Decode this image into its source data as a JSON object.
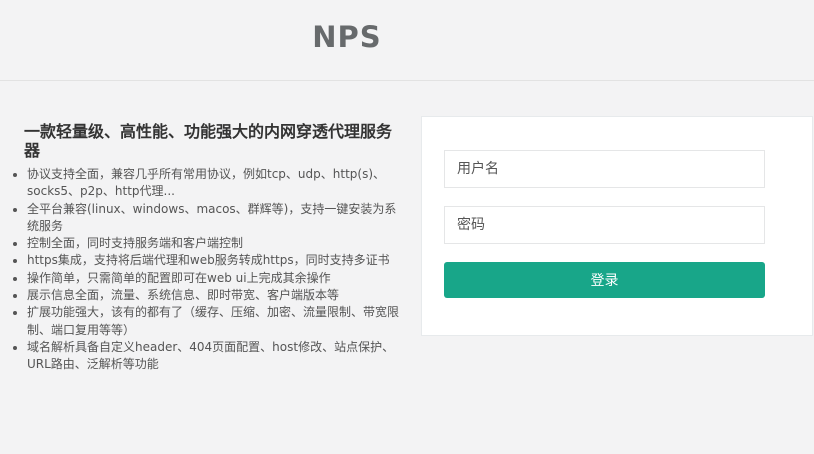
{
  "header": {
    "brand": "NPS"
  },
  "intro": {
    "title": "一款轻量级、高性能、功能强大的内网穿透代理服务器",
    "features": [
      "协议支持全面，兼容几乎所有常用协议，例如tcp、udp、http(s)、socks5、p2p、http代理...",
      "全平台兼容(linux、windows、macos、群辉等)，支持一键安装为系统服务",
      "控制全面，同时支持服务端和客户端控制",
      "https集成，支持将后端代理和web服务转成https，同时支持多证书",
      "操作简单，只需简单的配置即可在web ui上完成其余操作",
      "展示信息全面，流量、系统信息、即时带宽、客户端版本等",
      "扩展功能强大，该有的都有了（缓存、压缩、加密、流量限制、带宽限制、端口复用等等）",
      "域名解析具备自定义header、404页面配置、host修改、站点保护、URL路由、泛解析等功能"
    ]
  },
  "login": {
    "username_placeholder": "用户名",
    "password_placeholder": "密码",
    "submit_label": "登录"
  },
  "colors": {
    "accent": "#18a689",
    "background": "#f3f3f4"
  }
}
